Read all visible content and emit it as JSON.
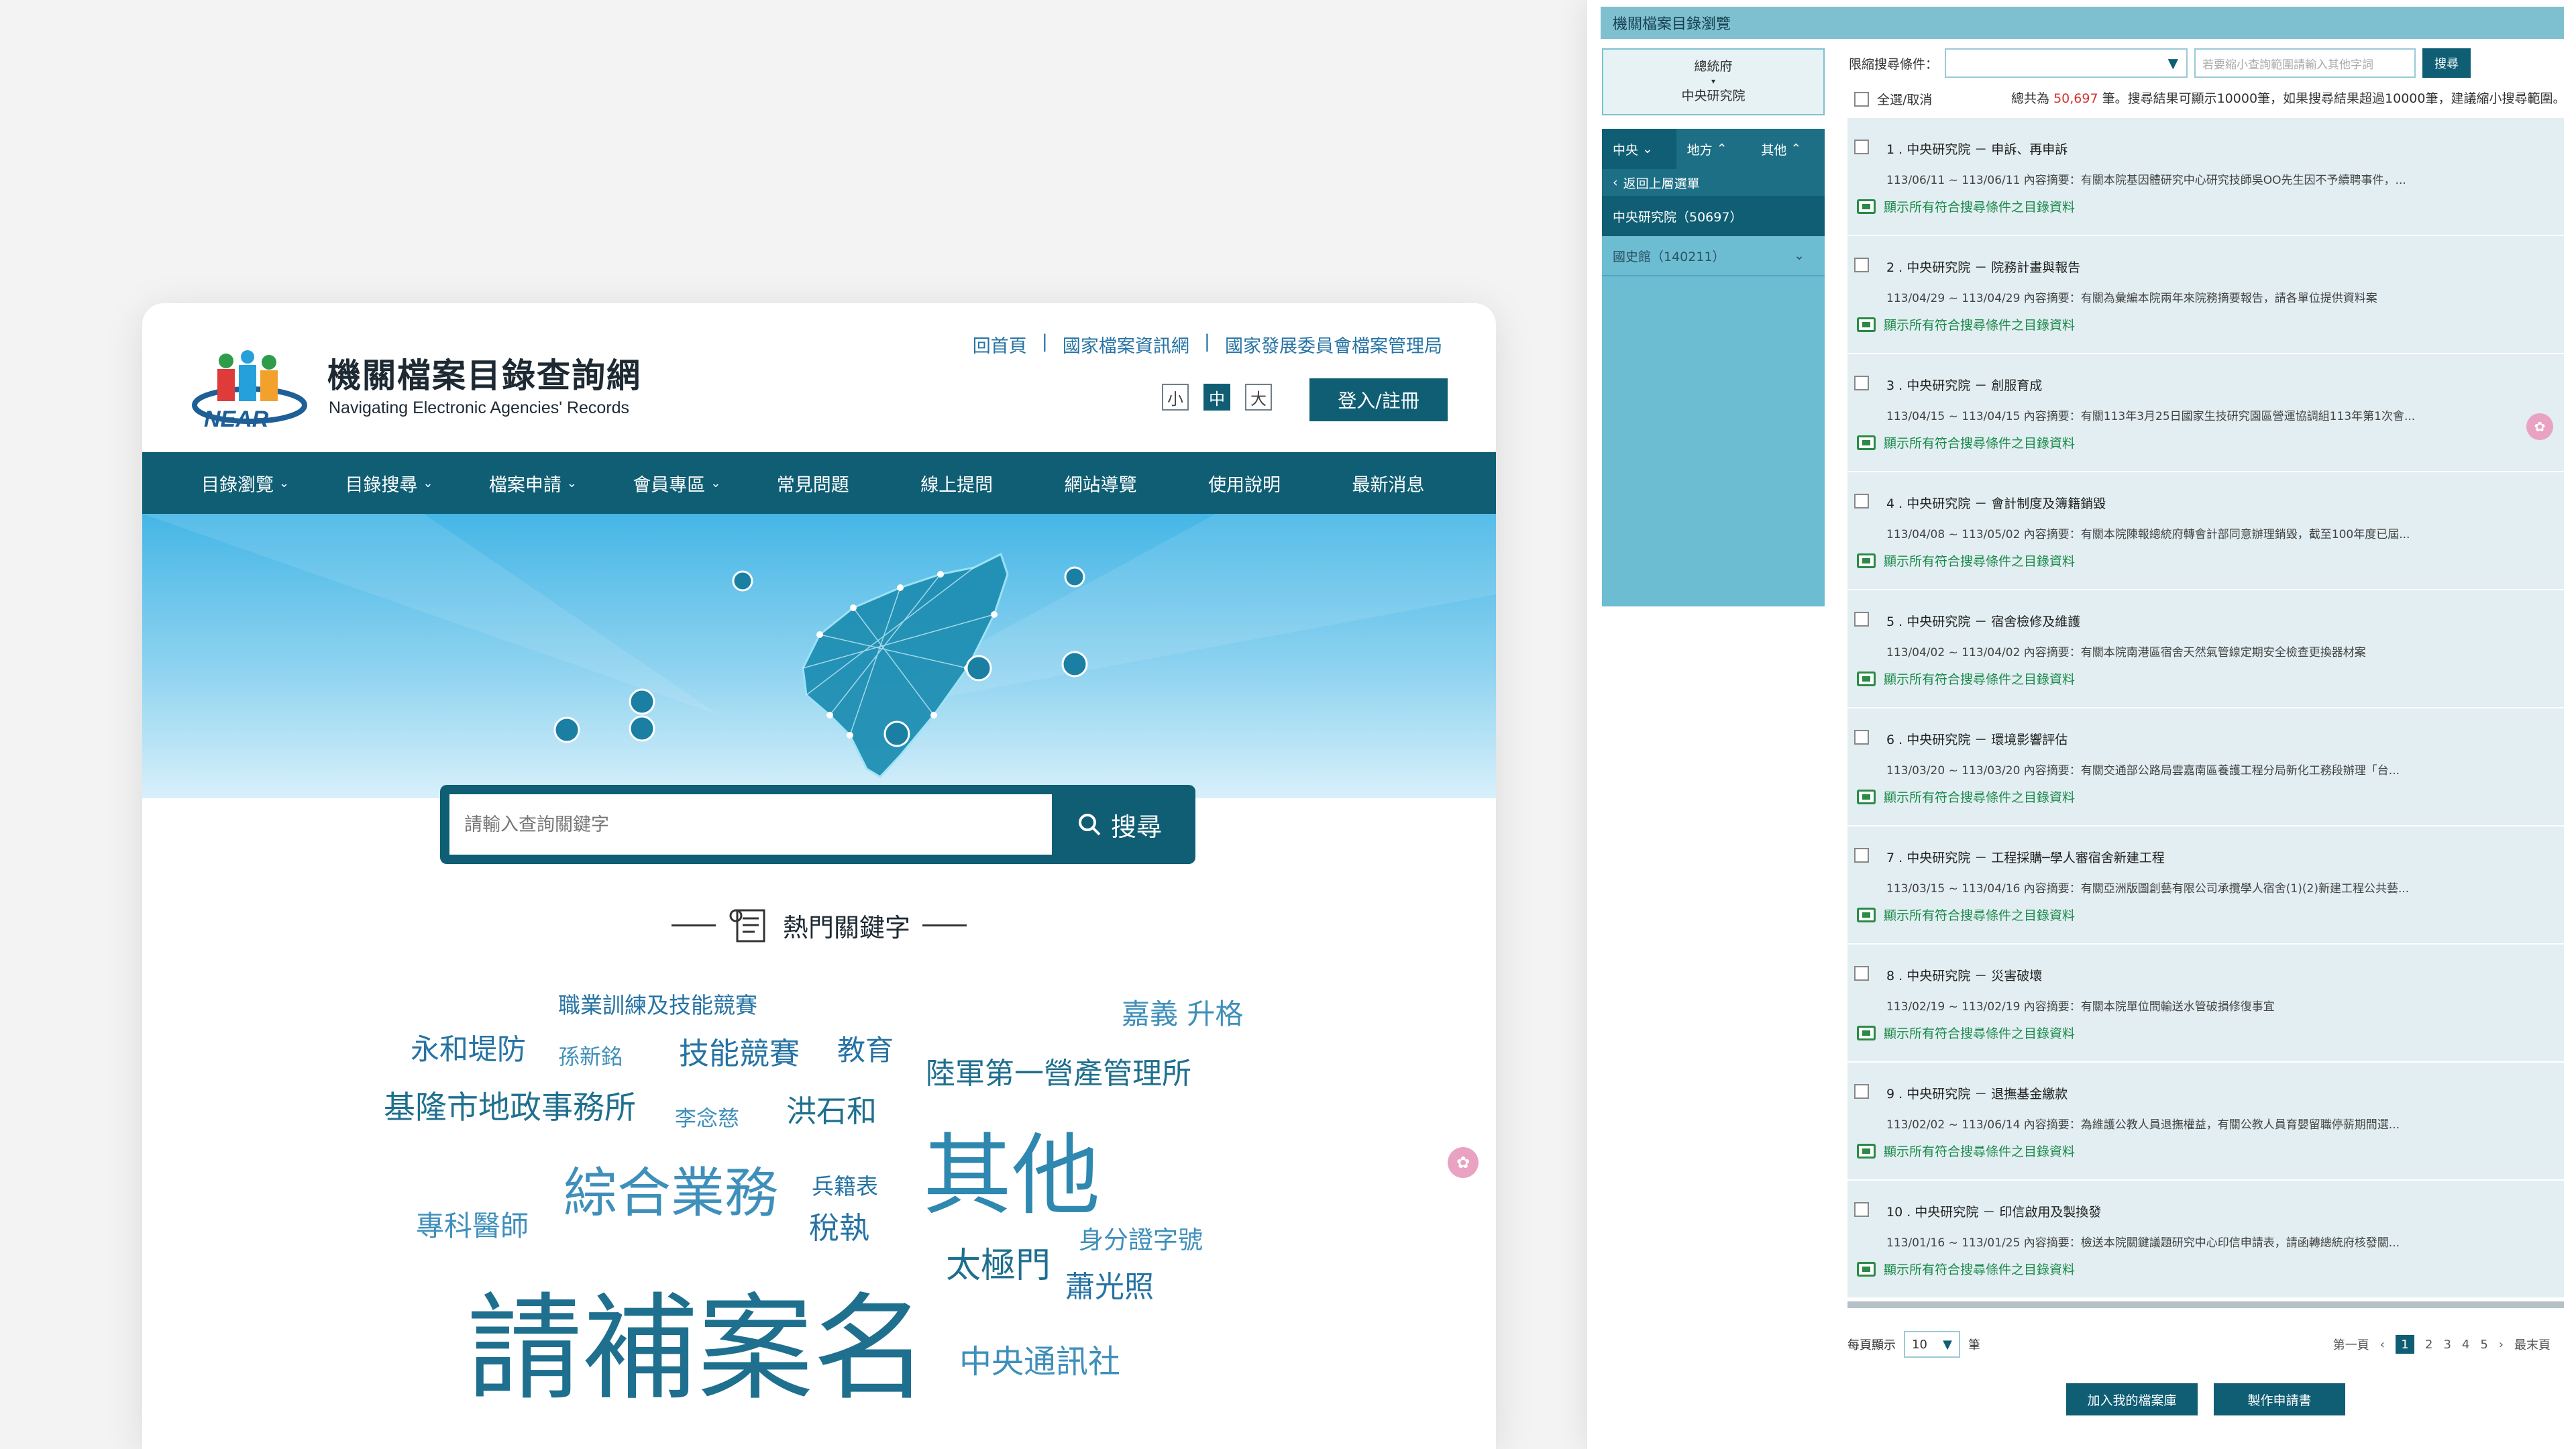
{
  "home": {
    "title": "機關檔案目錄查詢網",
    "subtitle": "Navigating Electronic Agencies' Records",
    "logo_text": "NEAR",
    "top_links": [
      "回首頁",
      "國家檔案資訊網",
      "國家發展委員會檔案管理局"
    ],
    "font_sizes": [
      "小",
      "中",
      "大"
    ],
    "login_label": "登入/註冊",
    "nav": [
      {
        "label": "目錄瀏覽",
        "chevron": true
      },
      {
        "label": "目錄搜尋",
        "chevron": true
      },
      {
        "label": "檔案申請",
        "chevron": true
      },
      {
        "label": "會員專區",
        "chevron": true
      },
      {
        "label": "常見問題",
        "chevron": false
      },
      {
        "label": "線上提問",
        "chevron": false
      },
      {
        "label": "網站導覽",
        "chevron": false
      },
      {
        "label": "使用說明",
        "chevron": false
      },
      {
        "label": "最新消息",
        "chevron": false
      }
    ],
    "search_placeholder": "請輸入查詢關鍵字",
    "search_label": "搜尋",
    "hot_title": "熱門關鍵字",
    "keywords": [
      "職業訓練及技能競賽",
      "嘉義 升格",
      "永和堤防",
      "孫新銘",
      "技能競賽",
      "教育",
      "陸軍第一營產管理所",
      "基隆市地政事務所",
      "李念慈",
      "洪石和",
      "其他",
      "綜合業務",
      "兵籍表",
      "專科醫師",
      "稅執",
      "身分證字號",
      "太極門",
      "蕭光照",
      "請補案名",
      "中央通訊社"
    ]
  },
  "browse": {
    "title": "機關檔案目錄瀏覽",
    "agency_top": "總統府",
    "agency_bottom": "中央研究院",
    "tabs": [
      "中央",
      "地方",
      "其他"
    ],
    "back_label": "返回上層選單",
    "side_items": [
      "中央研究院（50697）",
      "國史館（140211）"
    ],
    "filter_label": "限縮搜尋條件：",
    "filter_input_placeholder": "若要縮小查詢範圍請輸入其他字詞",
    "filter_button": "搜尋",
    "select_all": "全選/取消",
    "total_prefix": "總共為",
    "total_count": "50,697",
    "total_suffix": "筆。搜尋結果可顯示10000筆，如果搜尋結果超過10000筆，建議縮小搜尋範圍。",
    "show_all_link": "顯示所有符合搜尋條件之目錄資料",
    "results": [
      {
        "title": "1 . 中央研究院 － 申訴、再申訴",
        "desc": "113/06/11 ~ 113/06/11  內容摘要：有關本院基因體研究中心研究技師吳OO先生因不予續聘事件，..."
      },
      {
        "title": "2 . 中央研究院 － 院務計畫與報告",
        "desc": "113/04/29 ~ 113/04/29  內容摘要：有關為彙編本院兩年來院務摘要報告，請各單位提供資料案"
      },
      {
        "title": "3 . 中央研究院 － 創服育成",
        "desc": "113/04/15 ~ 113/04/15  內容摘要：有關113年3月25日國家生技研究園區營運協調組113年第1次會..."
      },
      {
        "title": "4 . 中央研究院 － 會計制度及簿籍銷毀",
        "desc": "113/04/08 ~ 113/05/02  內容摘要：有關本院陳報總統府轉會計部同意辦理銷毀，截至100年度已屆..."
      },
      {
        "title": "5 . 中央研究院 － 宿舍檢修及維護",
        "desc": "113/04/02 ~ 113/04/02  內容摘要：有關本院南港區宿舍天然氣管線定期安全檢查更換器材案"
      },
      {
        "title": "6 . 中央研究院 － 環境影響評估",
        "desc": "113/03/20 ~ 113/03/20  內容摘要：有關交通部公路局雲嘉南區養護工程分局新化工務段辦理「台..."
      },
      {
        "title": "7 . 中央研究院 － 工程採購─學人審宿舍新建工程",
        "desc": "113/03/15 ~ 113/04/16  內容摘要：有關亞洲版圖創藝有限公司承攬學人宿舍(1)(2)新建工程公共藝..."
      },
      {
        "title": "8 . 中央研究院 － 災害破壞",
        "desc": "113/02/19 ~ 113/02/19  內容摘要：有關本院單位間輸送水管破損修復事宜"
      },
      {
        "title": "9 . 中央研究院 － 退撫基金繳款",
        "desc": "113/02/02 ~ 113/06/14  內容摘要：為維護公教人員退撫權益，有關公教人員育嬰留職停薪期間選..."
      },
      {
        "title": "10 . 中央研究院 － 印信啟用及製換發",
        "desc": "113/01/16 ~ 113/01/25  內容摘要：檢送本院關鍵議題研究中心印信申請表，請函轉總統府核發關..."
      }
    ],
    "per_page_label": "每頁顯示",
    "per_page_value": "10",
    "per_page_unit": "筆",
    "first_page": "第一頁",
    "pages": [
      "1",
      "2",
      "3",
      "4",
      "5"
    ],
    "next": "›",
    "prev": "‹",
    "last_page": "最末頁",
    "add_button": "加入我的檔案庫",
    "make_button": "製作申請書"
  },
  "colors": {
    "primary": "#0f5e74",
    "link": "#2673a4",
    "sidebar": "#6cbcd2",
    "result_bg": "#e2eef1",
    "green_link": "#1b8a4b",
    "count_red": "#d3322c"
  }
}
